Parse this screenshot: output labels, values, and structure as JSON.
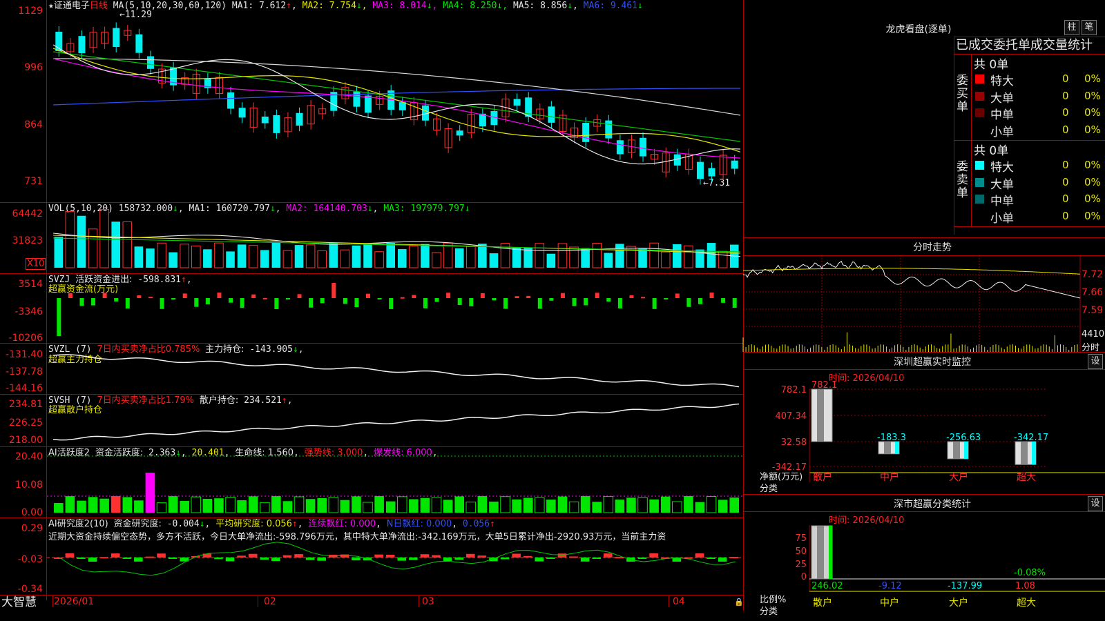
{
  "stock": {
    "star": "★",
    "name": "证通电子",
    "period": "日线"
  },
  "price_panel": {
    "ma_label": "MA(5,10,20,30,60,120)",
    "ma": [
      {
        "name": "MA1",
        "value": "7.612",
        "arrow": "↑",
        "color": "#e6e6e6"
      },
      {
        "name": "MA2",
        "value": "7.754",
        "arrow": "↓",
        "color": "#e6e600"
      },
      {
        "name": "MA3",
        "value": "8.014",
        "arrow": "↓",
        "color": "#ff00ff"
      },
      {
        "name": "MA4",
        "value": "8.250",
        "arrow": "↓",
        "color": "#00e600"
      },
      {
        "name": "MA5",
        "value": "8.856",
        "arrow": "↓",
        "color": "#e6e6e6"
      },
      {
        "name": "MA6",
        "value": "9.461",
        "arrow": "↓",
        "color": "#3050ff"
      }
    ],
    "high_mark": "11.29",
    "low_mark": "7.31",
    "yticks": [
      "1129",
      "996",
      "864",
      "731"
    ]
  },
  "vol_panel": {
    "label": "VOL(5,10,20)",
    "value": "158732.000",
    "arrow": "↓",
    "ma": [
      {
        "name": "MA1",
        "value": "160720.797",
        "arrow": "↓"
      },
      {
        "name": "MA2",
        "value": "164140.703",
        "arrow": "↓"
      },
      {
        "name": "MA3",
        "value": "197979.797",
        "arrow": "↓"
      }
    ],
    "yticks": [
      "64442",
      "31823"
    ],
    "unit": "X10"
  },
  "svzj_panel": {
    "label": "SVZJ",
    "item": "活跃资金进出:",
    "value": "-598.831",
    "arrow": "↑",
    "sub": "超赢资金流(万元)",
    "yticks": [
      "3514",
      "-3346",
      "-10206"
    ]
  },
  "svzl_panel": {
    "label": "SVZL (7)",
    "ratio": "7日内买卖净占比0.785%",
    "item": "主力持仓:",
    "value": "-143.905",
    "arrow": "↓",
    "sub": "超赢主力持仓",
    "yticks": [
      "-131.40",
      "-137.78",
      "-144.16"
    ]
  },
  "svsh_panel": {
    "label": "SVSH (7)",
    "ratio": "7日内买卖净占比1.79%",
    "item": "散户持仓:",
    "value": "234.521",
    "arrow": "↑",
    "sub": "超赢散户持仓",
    "yticks": [
      "234.81",
      "226.25",
      "218.00"
    ]
  },
  "ai_active_panel": {
    "label": "AI活跃度2",
    "item": "资金活跃度:",
    "value": "2.363",
    "arrow": "↓",
    "v2": "20.401",
    "life": "生命线: 1.560",
    "strong": "强势线: 3.000",
    "burst": "爆发线: 6.000",
    "yticks": [
      "20.40",
      "10.08",
      "0.00"
    ]
  },
  "ai_research_panel": {
    "label": "AI研究度2(10)",
    "item": "资金研究度:",
    "value": "-0.004",
    "arrow": "↓",
    "avg": "平均研究度: 0.056",
    "avg_arrow": "↑",
    "red1": "连续飘红: 0.000",
    "red2": "N日飘红: 0.000",
    "last": "0.056",
    "last_arrow": "↑",
    "summary": "近期大资金持续偏空态势，多方不活跃，今日大单净流出:-598.796万元，其中特大单净流出:-342.169万元，大单5日累计净出-2920.93万元，当前主力资",
    "yticks": [
      "0.29",
      "-0.03",
      "-0.34"
    ]
  },
  "xaxis": {
    "brand": "大智慧",
    "labels": [
      "2026/01",
      "02",
      "03",
      "04"
    ]
  },
  "dragon": {
    "title": "龙虎看盘(逐单)",
    "btn1": "柱",
    "btn2": "笔",
    "subtitle": "已成交委托单成交量统计",
    "buy": {
      "side": "委买单",
      "total": "共 0单",
      "rows": [
        {
          "name": "特大",
          "count": "0",
          "pct": "0%",
          "color": "#ff0000"
        },
        {
          "name": "大单",
          "count": "0",
          "pct": "0%",
          "color": "#9b0000"
        },
        {
          "name": "中单",
          "count": "0",
          "pct": "0%",
          "color": "#6a0000"
        },
        {
          "name": "小单",
          "count": "0",
          "pct": "0%",
          "color": ""
        }
      ]
    },
    "sell": {
      "side": "委卖单",
      "total": "共 0单",
      "rows": [
        {
          "name": "特大",
          "count": "0",
          "pct": "0%",
          "color": "#00ffff"
        },
        {
          "name": "大单",
          "count": "0",
          "pct": "0%",
          "color": "#008c8c"
        },
        {
          "name": "中单",
          "count": "0",
          "pct": "0%",
          "color": "#006a6a"
        },
        {
          "name": "小单",
          "count": "0",
          "pct": "0%",
          "color": ""
        }
      ]
    }
  },
  "intraday": {
    "title": "分时走势",
    "yticks": [
      "7.72",
      "7.66",
      "7.59"
    ],
    "vol": "4410",
    "vol_unit": "分时"
  },
  "sz_monitor": {
    "title": "深圳超赢实时监控",
    "btn": "设",
    "date": "时间: 2026/04/10",
    "yticks": [
      "782.1",
      "407.34",
      "32.58",
      "-342.17"
    ],
    "ylab": "净额(万元)",
    "xlab": "分类",
    "chart_data": {
      "type": "bar",
      "categories": [
        "散户",
        "中户",
        "大户",
        "超大"
      ],
      "values": [
        782.1,
        -183.3,
        -256.63,
        -342.17
      ]
    }
  },
  "sz_class": {
    "title": "深市超赢分类统计",
    "btn": "设",
    "date": "时间: 2026/04/10",
    "yticks": [
      "75",
      "50",
      "25",
      "0"
    ],
    "ylab": "比例%",
    "xlab": "分类",
    "note": "-0.08%",
    "chart_data": {
      "type": "bar",
      "categories": [
        "散户",
        "中户",
        "大户",
        "超大"
      ],
      "values": [
        246.02,
        -9.12,
        -137.99,
        1.08
      ]
    }
  }
}
